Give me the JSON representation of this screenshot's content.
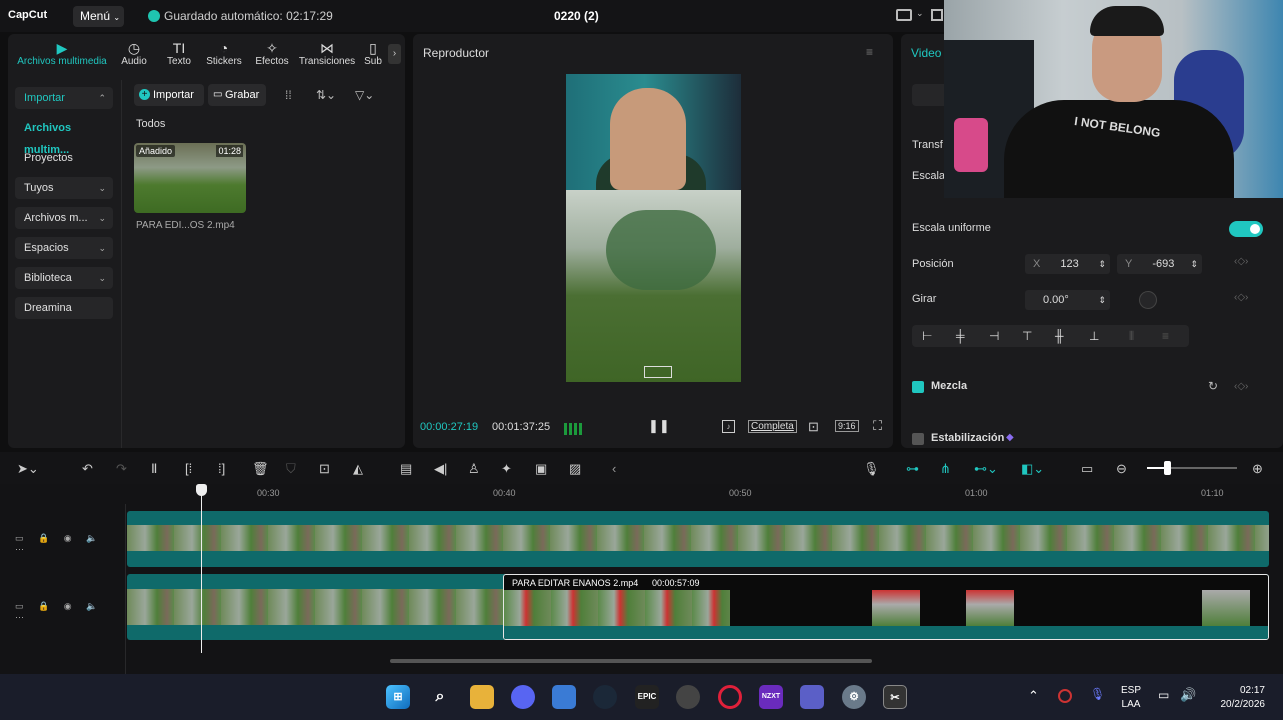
{
  "app": {
    "logo": "CapCut",
    "menu_label": "Menú",
    "autosave": "Guardado automático: 02:17:29",
    "project_title": "0220 (2)"
  },
  "media_panel": {
    "tabs": [
      {
        "label": "Archivos multimedia",
        "icon": "media-icon"
      },
      {
        "label": "Audio",
        "icon": "audio-icon"
      },
      {
        "label": "Texto",
        "icon": "text-icon"
      },
      {
        "label": "Stickers",
        "icon": "sticker-icon"
      },
      {
        "label": "Efectos",
        "icon": "effects-icon"
      },
      {
        "label": "Transiciones",
        "icon": "transitions-icon"
      },
      {
        "label": "Sub",
        "icon": "subtitles-icon"
      }
    ],
    "sidebar": [
      {
        "label": "Importar"
      },
      {
        "label": "Archivos multim..."
      },
      {
        "label": "Proyectos secun..."
      },
      {
        "label": "Tuyos"
      },
      {
        "label": "Archivos m..."
      },
      {
        "label": "Espacios"
      },
      {
        "label": "Biblioteca"
      },
      {
        "label": "Dreamina"
      }
    ],
    "import_label": "Importar",
    "record_label": "Grabar",
    "filter_label": "Todos",
    "item": {
      "badge": "Añadido",
      "duration": "01:28",
      "name": "PARA EDI...OS 2.mp4"
    }
  },
  "player": {
    "title": "Reproductor",
    "current_time": "00:00:27:19",
    "total_time": "00:01:37:25",
    "fullscreen_label": "Completa",
    "ratio_label": "9:16"
  },
  "properties": {
    "title": "Video",
    "transform_label": "Transf",
    "scale_label": "Escala",
    "uniform_scale": "Escala uniforme",
    "position_label": "Posición",
    "x_label": "X",
    "x_value": "123",
    "y_label": "Y",
    "y_value": "-693",
    "rotate_label": "Girar",
    "rotate_value": "0.00°",
    "blend_label": "Mezcla",
    "stabilize_label": "Estabilización"
  },
  "webcam": {
    "shirt_text": "I NOT BELONG"
  },
  "timeline": {
    "ticks": [
      "00:30",
      "00:40",
      "00:50",
      "01:00",
      "01:10"
    ],
    "clip_name": "PARA EDITAR ENANOS 2.mp4",
    "clip_duration": "00:00:57:09"
  },
  "taskbar": {
    "apps": [
      "windows",
      "search",
      "file-explorer",
      "discord",
      "store",
      "steam",
      "epic",
      "chrome",
      "opera",
      "nzxt",
      "teams",
      "settings",
      "capcut"
    ],
    "epic_label": "EPIC",
    "nzxt_label": "NZXT",
    "lang_1": "ESP",
    "lang_2": "LAA",
    "time": "02:17",
    "date": "20/2/2026"
  },
  "colors": {
    "accent": "#20c7c0",
    "track": "#0f6a6a",
    "background": "#0f0f10"
  }
}
